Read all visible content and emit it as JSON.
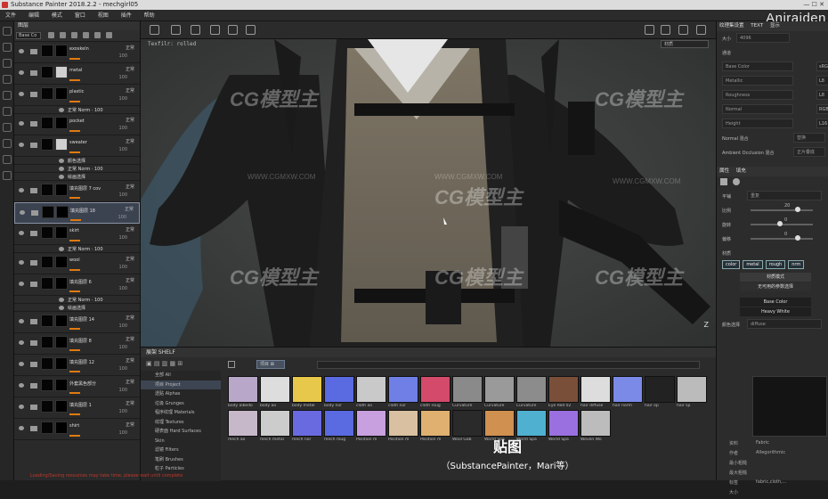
{
  "app": {
    "title": "Substance Painter 2018.2.2 - mechgirl05",
    "brand_watermark": "Aniraiden"
  },
  "menu": [
    "文件",
    "编辑",
    "模式",
    "窗口",
    "视图",
    "插件",
    "帮助"
  ],
  "layers": {
    "header": "图层",
    "channel_select": "Base Co",
    "items": [
      {
        "name": "exoskeln",
        "blend": "正常",
        "opacity": "100"
      },
      {
        "name": "metal",
        "blend": "正常",
        "opacity": "100"
      },
      {
        "name": "plastic",
        "blend": "正常",
        "opacity": "100"
      },
      {
        "name": "正常 Norm · 100",
        "sub": true
      },
      {
        "name": "pocket",
        "blend": "正常",
        "opacity": "100"
      },
      {
        "name": "sweater",
        "blend": "正常",
        "opacity": "100"
      },
      {
        "name": "颜色选择",
        "sub": true
      },
      {
        "name": "正常 Norm · 100",
        "sub": true
      },
      {
        "name": "绘画选择",
        "sub": true
      },
      {
        "name": "填充图层 7 cov",
        "blend": "正常",
        "opacity": "100"
      },
      {
        "name": "填充图层 18",
        "blend": "正常",
        "opacity": "100",
        "selected": true
      },
      {
        "name": "skirt",
        "blend": "正常",
        "opacity": "100"
      },
      {
        "name": "正常 Norm · 100",
        "sub": true
      },
      {
        "name": "wool",
        "blend": "正常",
        "opacity": "100"
      },
      {
        "name": "填充图层 6",
        "blend": "正常",
        "opacity": "100"
      },
      {
        "name": "正常 Norm · 100",
        "sub": true
      },
      {
        "name": "绘画选择",
        "sub": true
      },
      {
        "name": "填充图层 14",
        "blend": "正常",
        "opacity": "100"
      },
      {
        "name": "填充图层 8",
        "blend": "正常",
        "opacity": "100"
      },
      {
        "name": "填充图层 12",
        "blend": "正常",
        "opacity": "100"
      },
      {
        "name": "外套黑色部分",
        "blend": "正常",
        "opacity": "100"
      },
      {
        "name": "填充图层 1",
        "blend": "正常",
        "opacity": "100"
      },
      {
        "name": "shirt",
        "blend": "正常",
        "opacity": "100"
      }
    ]
  },
  "viewport": {
    "subbar_left": "Texfilr: rolled",
    "material_select": "材质",
    "axis_label": "Z"
  },
  "shelf": {
    "header": "展架  SHELF",
    "filter_chip": "项目 ⊠",
    "categories": [
      "全部 All",
      "项目 Project",
      "透贴 Alphas",
      "垃圾 Grunges",
      "程序纹理 Materials",
      "纹理 Textures",
      "硬表面 Hard Surfaces",
      "Skin",
      "滤镜 Filters",
      "笔刷 Brushes",
      "粒子 Particles"
    ],
    "active_category": 1,
    "row1": [
      "body albedo",
      "body ao",
      "body metal",
      "body nor",
      "cloth ao",
      "cloth nor",
      "cloth roug",
      "Curvature",
      "Curvature",
      "Curvature",
      "Eye Red 02",
      "hair diffuse",
      "hair norm",
      "hair op",
      "hair sp"
    ],
    "row2": [
      "mech ao",
      "mech metal",
      "mech nor",
      "mech roug",
      "Position m",
      "Position m",
      "Position m",
      "Wool Gab",
      "World Spa",
      "World Spa",
      "World Spa",
      "Woven Wo"
    ]
  },
  "caption": {
    "title": "贴图",
    "subtitle": "（SubstancePainter，Mari等）"
  },
  "properties": {
    "tabs": [
      "纹理集设置",
      "TEXT",
      "显示"
    ],
    "size_label": "大小",
    "size_value": "4096",
    "section_channels": "通道",
    "channels": [
      "Base Color",
      "Metallic",
      "Roughness",
      "Normal",
      "Height"
    ],
    "channel_formats": [
      "sRGB",
      "L8",
      "L8",
      "RGB",
      "L16"
    ],
    "normal_label": "Normal 混合",
    "normal_value": "替换",
    "ao_label": "Ambient Occlusion 混合",
    "ao_value": "正片叠底",
    "props_tabs": [
      "属性",
      "填充"
    ],
    "params": [
      {
        "label": "平铺",
        "value": "重复"
      },
      {
        "label": "比例",
        "value": "20"
      },
      {
        "label": "旋转",
        "value": "0"
      },
      {
        "label": "偏移",
        "value": "0"
      }
    ],
    "material_section": "材质",
    "material_channels": [
      "color",
      "metal",
      "rough",
      "nrm"
    ],
    "material_mode_title": "材质模式",
    "material_mode_value": "无可用的参数选择",
    "base_color_label": "Base Color",
    "base_color_value": "Heavy White",
    "diffuse_label": "颜色选择",
    "diffuse_value": "diffuse",
    "bottom_rows": [
      {
        "label": "资料",
        "value": "Fabric"
      },
      {
        "label": "作者",
        "value": "Allegorithmic"
      },
      {
        "label": "最小粗糙",
        "value": ""
      },
      {
        "label": "最大粗糙",
        "value": ""
      },
      {
        "label": "标签",
        "value": "fabric,cloth,...",
        "extra": true
      },
      {
        "label": "大小",
        "value": ""
      }
    ]
  },
  "status": {
    "warning": "Loading/Saving resources may take time, please wait until complete"
  },
  "watermarks": {
    "logo": "CG模型主",
    "site": "WWW.CGMXW.COM"
  }
}
